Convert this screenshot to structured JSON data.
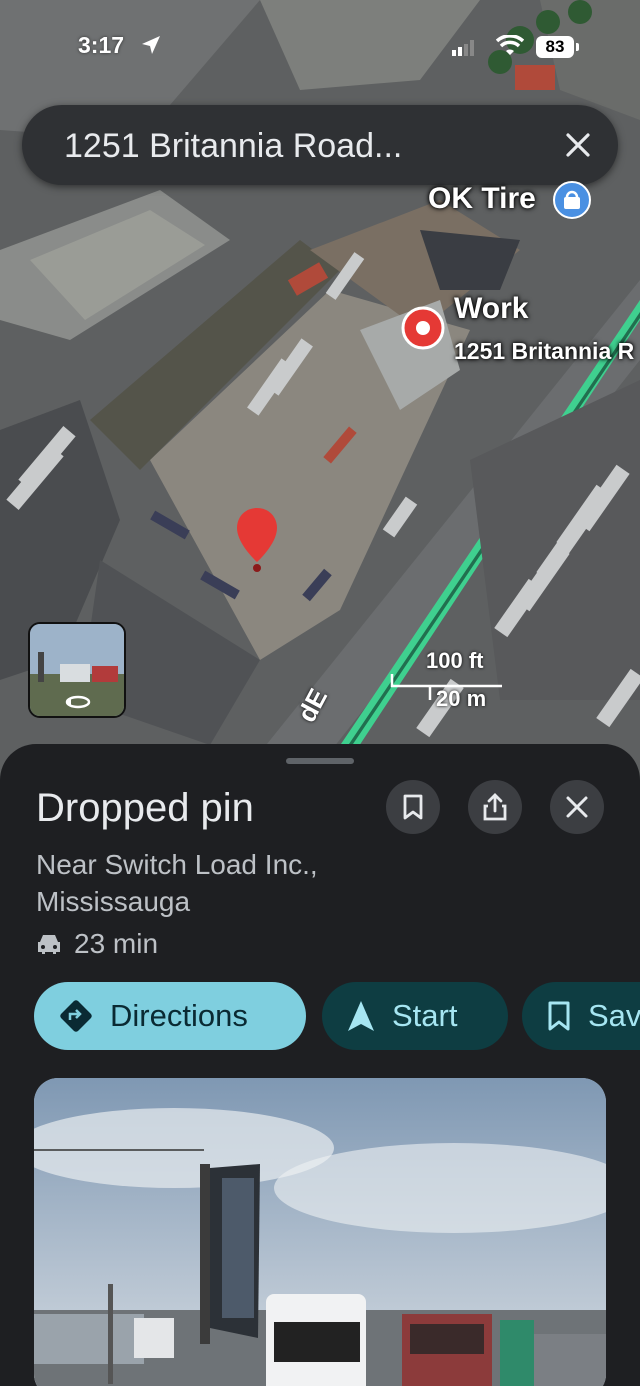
{
  "status_bar": {
    "time": "3:17",
    "battery": "83"
  },
  "search": {
    "query": "1251 Britannia Road..."
  },
  "map": {
    "business_label": "OK Tire",
    "saved_place_label": "Work",
    "saved_place_address": "1251 Britannia R",
    "road_label": "dE",
    "scale_imperial": "100 ft",
    "scale_metric": "20 m",
    "route_color": "#3fd08f",
    "pin_color": "#e53935"
  },
  "place": {
    "title": "Dropped pin",
    "subtitle": "Near Switch Load Inc., Mississauga",
    "travel_time": "23 min",
    "actions": {
      "directions": "Directions",
      "start": "Start",
      "save": "Sav"
    }
  },
  "icons": [
    "location-arrow-icon",
    "signal-icon",
    "wifi-icon",
    "close-icon",
    "bookmark-icon",
    "share-icon",
    "car-icon",
    "directions-icon",
    "navigation-arrow-icon",
    "street-view-rotate-icon"
  ]
}
